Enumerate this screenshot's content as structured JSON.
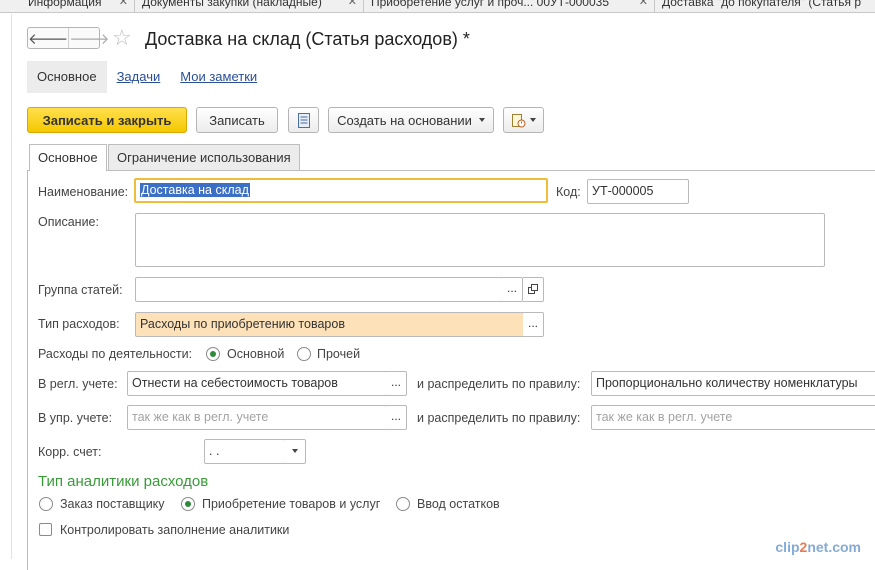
{
  "window_tabs": [
    {
      "label": "Информация"
    },
    {
      "label": "Документы закупки (накладные)"
    },
    {
      "label": "Приобретение услуг и проч... 00УТ-000035"
    },
    {
      "label": "Доставка \"до покупателя\" (Статья р"
    }
  ],
  "header": {
    "title": "Доставка на склад (Статья расходов) *"
  },
  "sections": [
    {
      "label": "Основное"
    },
    {
      "label": "Задачи"
    },
    {
      "label": "Мои заметки"
    }
  ],
  "toolbar": {
    "save_close": "Записать и закрыть",
    "save": "Записать",
    "create_based": "Создать на основании"
  },
  "form_tabs": [
    {
      "label": "Основное"
    },
    {
      "label": "Ограничение использования"
    }
  ],
  "form": {
    "name_label": "Наименование:",
    "name_value": "Доставка на склад",
    "code_label": "Код:",
    "code_value": "УТ-000005",
    "description_label": "Описание:",
    "description_value": "",
    "group_label": "Группа статей:",
    "group_value": "",
    "expense_type_label": "Тип расходов:",
    "expense_type_value": "Расходы по приобретению товаров",
    "activity_label": "Расходы по деятельности:",
    "activity_options": [
      "Основной",
      "Прочей"
    ],
    "activity_selected": "Основной",
    "reg_label": "В регл. учете:",
    "reg_value": "Отнести на себестоимость товаров",
    "distribute_label": "и распределить по правилу:",
    "reg_rule_value": "Пропорционально количеству номенклатуры",
    "mgmt_label": "В упр. учете:",
    "mgmt_placeholder": "так же как в регл. учете",
    "mgmt_distribute_label": "и распределить по правилу:",
    "mgmt_rule_placeholder": "так же как в регл. учете",
    "corr_label": "Корр. счет:",
    "corr_value": " .  ."
  },
  "analytics": {
    "title": "Тип аналитики расходов",
    "options": [
      "Заказ поставщику",
      "Приобретение товаров и услуг",
      "Ввод остатков"
    ],
    "selected": "Приобретение товаров и услуг",
    "control_label": "Контролировать заполнение аналитики",
    "control_checked": false
  },
  "watermark": {
    "left": "clip",
    "mid": "2",
    "right": "net.com"
  },
  "colors": {
    "primary_button": "#f5c800",
    "focus_border": "#f0bd3a",
    "required_field": "#fde1b8",
    "radio_dot": "#2f8a3a",
    "group_title": "#3a9a3a",
    "link": "#2a4f9c"
  }
}
